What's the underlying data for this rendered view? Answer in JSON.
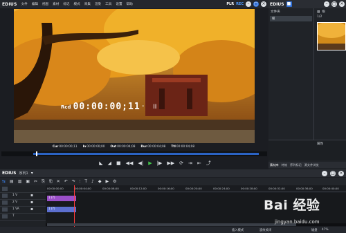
{
  "menubar": {
    "app": "EDIUS",
    "items": [
      "文件",
      "编辑",
      "视图",
      "素材",
      "标记",
      "模式",
      "采集",
      "渲染",
      "工具",
      "设置",
      "帮助"
    ],
    "plr": "PLR",
    "rec": "REC"
  },
  "preview": {
    "rcd": "Rcd",
    "timecode": "00:00:00;11",
    "star": "*",
    "pause": "II"
  },
  "tcstrip": [
    {
      "k": "Cur",
      "v": "00:00:00;11"
    },
    {
      "k": "In",
      "v": "00:00:00;00"
    },
    {
      "k": "Out",
      "v": "00:00:04;08"
    },
    {
      "k": "Dur",
      "v": "00:00:04;08"
    },
    {
      "k": "Ttl",
      "v": "00:00:04;08"
    }
  ],
  "right_panel": {
    "app": "EDIUS",
    "bin_title": "文件夹",
    "bin_item": "根",
    "assets_title": "根",
    "assets_path": "1/2",
    "props_title": "属性",
    "tabs": [
      "素材库",
      "特效",
      "序列标记",
      "源文件浏览"
    ]
  },
  "timeline": {
    "app": "EDIUS",
    "sequence": "序列1",
    "tab": "序列1",
    "ruler": [
      "00:00:00;00",
      "00:00:04;00",
      "00:00:08;00",
      "00:00:12;00",
      "00:00:16;00",
      "00:00:20;00",
      "00:00:24;00",
      "00:00:28;00",
      "00:00:32;00",
      "00:00:36;00",
      "00:00:40;00"
    ],
    "tracks": [
      {
        "num": "",
        "label": ""
      },
      {
        "num": "",
        "label": "1 V"
      },
      {
        "num": "",
        "label": "2 V"
      },
      {
        "num": "",
        "label": "1 VA"
      },
      {
        "num": "",
        "label": "T"
      }
    ],
    "clip1": "1 (7)",
    "clip2": "1 (7)"
  },
  "status": {
    "mode": "插入模式",
    "ripple": "波纹关闭",
    "disk_label": "磁盘",
    "disk_value": "47%"
  },
  "watermark": {
    "logo": "Bai 经验",
    "url": "jingyan.baidu.com"
  }
}
